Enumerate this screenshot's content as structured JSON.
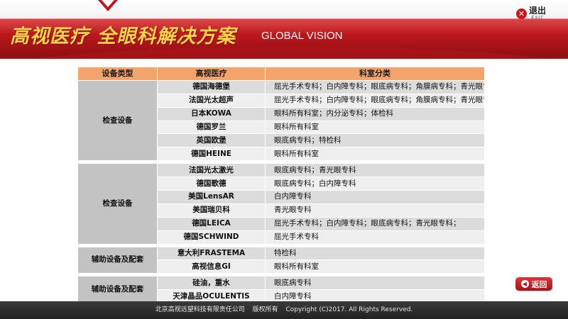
{
  "header": {
    "title_cn": "高视医疗 全眼科解决方案",
    "title_en": "GLOBAL VISION",
    "exit_cn": "退出",
    "exit_en": "EXIT",
    "brand_color": "#b4161b",
    "title_color": "#ffd34a"
  },
  "table": {
    "columns": [
      "设备类型",
      "高视医疗",
      "科室分类"
    ],
    "groups": [
      {
        "category": "检查设备",
        "rows": [
          {
            "brand": "德国海德堡",
            "dept": "屈光手术专科；白内障专科；眼底病专科；角膜病专科；青光眼专科；特检科"
          },
          {
            "brand": "法国光太超声",
            "dept": "屈光手术专科；白内障专科；眼底病专科；角膜病专科；青光眼专科；特检科"
          },
          {
            "brand": "日本KOWA",
            "dept": "眼科所有科室；内分泌专科；体检科"
          },
          {
            "brand": "德国罗兰",
            "dept": "眼科所有科室"
          },
          {
            "brand": "英国欧堡",
            "dept": "眼底病专科；特检科"
          },
          {
            "brand": "德国HEINE",
            "dept": "眼科所有科室"
          }
        ]
      },
      {
        "category": "检查设备",
        "rows": [
          {
            "brand": "法国光太激光",
            "dept": "眼底病专科；青光眼专科"
          },
          {
            "brand": "德国歌德",
            "dept": "眼底病专科；白内障专科"
          },
          {
            "brand": "美国LensAR",
            "dept": "白内障专科"
          },
          {
            "brand": "美国瑞贝科",
            "dept": "青光眼专科"
          },
          {
            "brand": "德国LEICA",
            "dept": "屈光手术专科；白内障专科；眼底病专科；青光眼专科；"
          },
          {
            "brand": "德国SCHWIND",
            "dept": "屈光手术专科"
          }
        ]
      },
      {
        "category": "辅助设备及配套",
        "rows": [
          {
            "brand": "意大利FRASTEMA",
            "dept": "特检科"
          },
          {
            "brand": "高视信息GI",
            "dept": "眼科所有科室"
          }
        ]
      },
      {
        "category": "辅助设备及配套",
        "rows": [
          {
            "brand": "硅油，重水",
            "dept": "眼底病专科"
          },
          {
            "brand": "天津晶品OCULENTIS",
            "dept": "白内障专科"
          }
        ]
      }
    ]
  },
  "back_button": {
    "label": "返回",
    "icon": "back-arrow-icon"
  },
  "footer": {
    "company": "北京高视远望科技有限责任公司",
    "rights_cn": "版权所有",
    "copyright": "Copyright (C)2017. All Rights Reserved."
  }
}
